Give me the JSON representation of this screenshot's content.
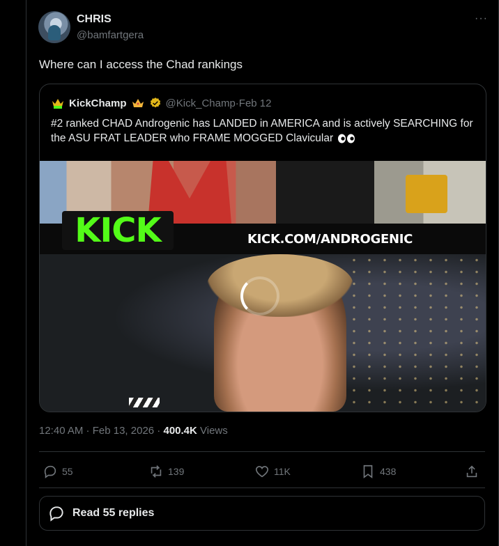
{
  "author": {
    "name": "CHRIS",
    "handle": "@bamfartgera"
  },
  "more_label": "···",
  "tweet_text": "Where can I access the Chad rankings",
  "quote": {
    "name": "KickChamp",
    "handle": "@Kick_Champ",
    "separator": " · ",
    "date": "Feb 12",
    "text": "#2 ranked CHAD Androgenic has LANDED in AMERICA and is actively SEARCHING for the ASU FRAT LEADER who FRAME MOGGED Clavicular",
    "media": {
      "logo_text": "KICK",
      "url_text": "KICK.COM/ANDROGENIC"
    },
    "verified_color": "#e2b719"
  },
  "meta": {
    "time": "12:40 AM",
    "sep1": " · ",
    "date": "Feb 13, 2026",
    "sep2": " · ",
    "views": "400.4K",
    "views_label": " Views"
  },
  "actions": {
    "replies": "55",
    "reposts": "139",
    "likes": "11K",
    "bookmarks": "438"
  },
  "read_replies_label": "Read 55 replies",
  "colors": {
    "background": "#000000",
    "text": "#e7e9ea",
    "secondary": "#71767b",
    "border": "#2f3336",
    "kick_green": "#53fc18"
  }
}
